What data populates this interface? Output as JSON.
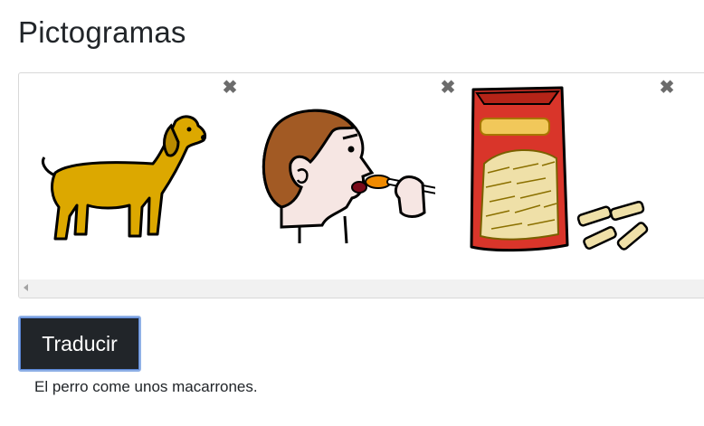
{
  "page": {
    "title": "Pictogramas"
  },
  "pictograms": [
    {
      "name": "perro",
      "remove_icon": "close-icon",
      "remove_glyph": "✖"
    },
    {
      "name": "comer",
      "remove_icon": "close-icon",
      "remove_glyph": "✖"
    },
    {
      "name": "macarrones",
      "remove_icon": "close-icon",
      "remove_glyph": "✖"
    }
  ],
  "actions": {
    "translate_label": "Traducir"
  },
  "result": {
    "text": "El perro come unos macarrones."
  },
  "colors": {
    "button_bg": "#212529",
    "button_focus_ring": "#8fb0e6",
    "dog_fill": "#dca800",
    "pasta_bag": "#d9352a",
    "pasta_fill": "#efe0a8"
  }
}
